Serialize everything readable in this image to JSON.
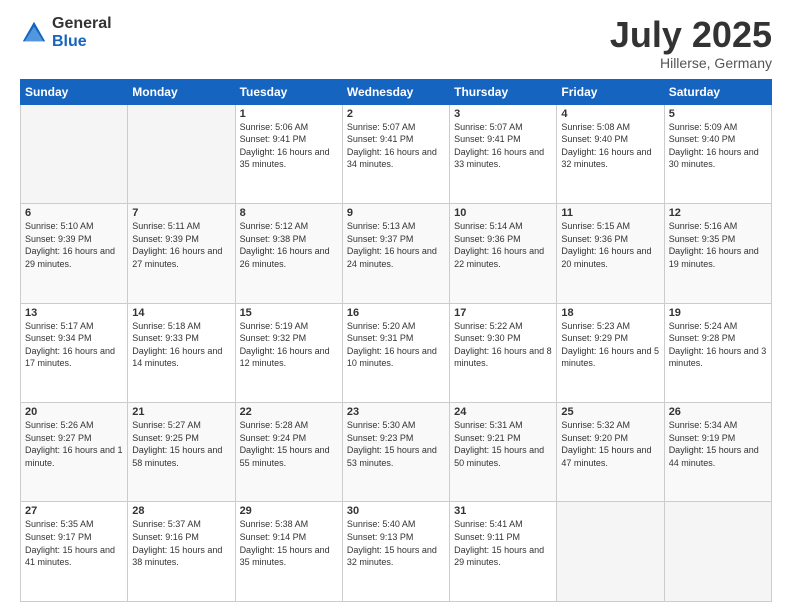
{
  "logo": {
    "general": "General",
    "blue": "Blue"
  },
  "header": {
    "title": "July 2025",
    "subtitle": "Hillerse, Germany"
  },
  "weekdays": [
    "Sunday",
    "Monday",
    "Tuesday",
    "Wednesday",
    "Thursday",
    "Friday",
    "Saturday"
  ],
  "weeks": [
    [
      {
        "day": "",
        "info": ""
      },
      {
        "day": "",
        "info": ""
      },
      {
        "day": "1",
        "info": "Sunrise: 5:06 AM\nSunset: 9:41 PM\nDaylight: 16 hours and 35 minutes."
      },
      {
        "day": "2",
        "info": "Sunrise: 5:07 AM\nSunset: 9:41 PM\nDaylight: 16 hours and 34 minutes."
      },
      {
        "day": "3",
        "info": "Sunrise: 5:07 AM\nSunset: 9:41 PM\nDaylight: 16 hours and 33 minutes."
      },
      {
        "day": "4",
        "info": "Sunrise: 5:08 AM\nSunset: 9:40 PM\nDaylight: 16 hours and 32 minutes."
      },
      {
        "day": "5",
        "info": "Sunrise: 5:09 AM\nSunset: 9:40 PM\nDaylight: 16 hours and 30 minutes."
      }
    ],
    [
      {
        "day": "6",
        "info": "Sunrise: 5:10 AM\nSunset: 9:39 PM\nDaylight: 16 hours and 29 minutes."
      },
      {
        "day": "7",
        "info": "Sunrise: 5:11 AM\nSunset: 9:39 PM\nDaylight: 16 hours and 27 minutes."
      },
      {
        "day": "8",
        "info": "Sunrise: 5:12 AM\nSunset: 9:38 PM\nDaylight: 16 hours and 26 minutes."
      },
      {
        "day": "9",
        "info": "Sunrise: 5:13 AM\nSunset: 9:37 PM\nDaylight: 16 hours and 24 minutes."
      },
      {
        "day": "10",
        "info": "Sunrise: 5:14 AM\nSunset: 9:36 PM\nDaylight: 16 hours and 22 minutes."
      },
      {
        "day": "11",
        "info": "Sunrise: 5:15 AM\nSunset: 9:36 PM\nDaylight: 16 hours and 20 minutes."
      },
      {
        "day": "12",
        "info": "Sunrise: 5:16 AM\nSunset: 9:35 PM\nDaylight: 16 hours and 19 minutes."
      }
    ],
    [
      {
        "day": "13",
        "info": "Sunrise: 5:17 AM\nSunset: 9:34 PM\nDaylight: 16 hours and 17 minutes."
      },
      {
        "day": "14",
        "info": "Sunrise: 5:18 AM\nSunset: 9:33 PM\nDaylight: 16 hours and 14 minutes."
      },
      {
        "day": "15",
        "info": "Sunrise: 5:19 AM\nSunset: 9:32 PM\nDaylight: 16 hours and 12 minutes."
      },
      {
        "day": "16",
        "info": "Sunrise: 5:20 AM\nSunset: 9:31 PM\nDaylight: 16 hours and 10 minutes."
      },
      {
        "day": "17",
        "info": "Sunrise: 5:22 AM\nSunset: 9:30 PM\nDaylight: 16 hours and 8 minutes."
      },
      {
        "day": "18",
        "info": "Sunrise: 5:23 AM\nSunset: 9:29 PM\nDaylight: 16 hours and 5 minutes."
      },
      {
        "day": "19",
        "info": "Sunrise: 5:24 AM\nSunset: 9:28 PM\nDaylight: 16 hours and 3 minutes."
      }
    ],
    [
      {
        "day": "20",
        "info": "Sunrise: 5:26 AM\nSunset: 9:27 PM\nDaylight: 16 hours and 1 minute."
      },
      {
        "day": "21",
        "info": "Sunrise: 5:27 AM\nSunset: 9:25 PM\nDaylight: 15 hours and 58 minutes."
      },
      {
        "day": "22",
        "info": "Sunrise: 5:28 AM\nSunset: 9:24 PM\nDaylight: 15 hours and 55 minutes."
      },
      {
        "day": "23",
        "info": "Sunrise: 5:30 AM\nSunset: 9:23 PM\nDaylight: 15 hours and 53 minutes."
      },
      {
        "day": "24",
        "info": "Sunrise: 5:31 AM\nSunset: 9:21 PM\nDaylight: 15 hours and 50 minutes."
      },
      {
        "day": "25",
        "info": "Sunrise: 5:32 AM\nSunset: 9:20 PM\nDaylight: 15 hours and 47 minutes."
      },
      {
        "day": "26",
        "info": "Sunrise: 5:34 AM\nSunset: 9:19 PM\nDaylight: 15 hours and 44 minutes."
      }
    ],
    [
      {
        "day": "27",
        "info": "Sunrise: 5:35 AM\nSunset: 9:17 PM\nDaylight: 15 hours and 41 minutes."
      },
      {
        "day": "28",
        "info": "Sunrise: 5:37 AM\nSunset: 9:16 PM\nDaylight: 15 hours and 38 minutes."
      },
      {
        "day": "29",
        "info": "Sunrise: 5:38 AM\nSunset: 9:14 PM\nDaylight: 15 hours and 35 minutes."
      },
      {
        "day": "30",
        "info": "Sunrise: 5:40 AM\nSunset: 9:13 PM\nDaylight: 15 hours and 32 minutes."
      },
      {
        "day": "31",
        "info": "Sunrise: 5:41 AM\nSunset: 9:11 PM\nDaylight: 15 hours and 29 minutes."
      },
      {
        "day": "",
        "info": ""
      },
      {
        "day": "",
        "info": ""
      }
    ]
  ]
}
